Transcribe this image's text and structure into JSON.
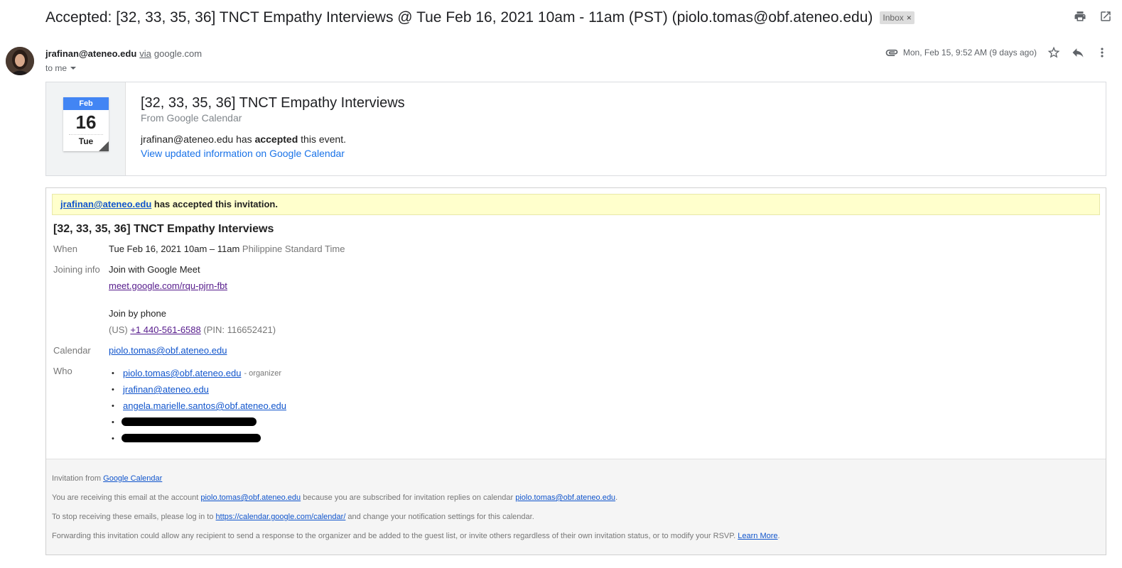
{
  "subject": "Accepted: [32, 33, 35, 36] TNCT Empathy Interviews @ Tue Feb 16, 2021 10am - 11am (PST) (piolo.tomas@obf.ateneo.edu)",
  "label": "Inbox",
  "label_remove": "×",
  "sender": {
    "email": "jrafinan@ateneo.edu",
    "via": "via",
    "via_domain": "google.com",
    "to": "to me",
    "date": "Mon, Feb 15, 9:52 AM (9 days ago)"
  },
  "card": {
    "month": "Feb",
    "day": "16",
    "weekday": "Tue",
    "title": "[32, 33, 35, 36] TNCT Empathy Interviews",
    "from": "From Google Calendar",
    "status_pre": "jrafinan@ateneo.edu has ",
    "status_bold": "accepted",
    "status_post": " this event.",
    "link": "View updated information on Google Calendar"
  },
  "invite": {
    "banner_link": "jrafinan@ateneo.edu",
    "banner_text": " has accepted this invitation.",
    "title": "[32, 33, 35, 36] TNCT Empathy Interviews",
    "when_label": "When",
    "when_value": "Tue Feb 16, 2021 10am – 11am",
    "when_tz": " Philippine Standard Time",
    "joining_label": "Joining info",
    "join_meet": "Join with Google Meet",
    "meet_link": "meet.google.com/rqu-pjrn-fbt",
    "join_phone": "Join by phone",
    "phone_country": "(US) ",
    "phone_number": "+1 440-561-6588",
    "phone_pin": " (PIN: 116652421)",
    "calendar_label": "Calendar",
    "calendar_value": "piolo.tomas@obf.ateneo.edu",
    "who_label": "Who",
    "guests": [
      {
        "email": "piolo.tomas@obf.ateneo.edu",
        "note": "- organizer"
      },
      {
        "email": "jrafinan@ateneo.edu",
        "note": ""
      },
      {
        "email": "angela.marielle.santos@obf.ateneo.edu",
        "note": ""
      }
    ]
  },
  "footer": {
    "l1_pre": "Invitation from ",
    "l1_link": "Google Calendar",
    "l2_pre": "You are receiving this email at the account ",
    "l2_link1": "piolo.tomas@obf.ateneo.edu",
    "l2_mid": " because you are subscribed for invitation replies on calendar ",
    "l2_link2": "piolo.tomas@obf.ateneo.edu",
    "l2_post": ".",
    "l3_pre": "To stop receiving these emails, please log in to ",
    "l3_link": "https://calendar.google.com/calendar/",
    "l3_post": " and change your notification settings for this calendar.",
    "l4_pre": "Forwarding this invitation could allow any recipient to send a response to the organizer and be added to the guest list, or invite others regardless of their own invitation status, or to modify your RSVP. ",
    "l4_link": "Learn More",
    "l4_post": "."
  }
}
